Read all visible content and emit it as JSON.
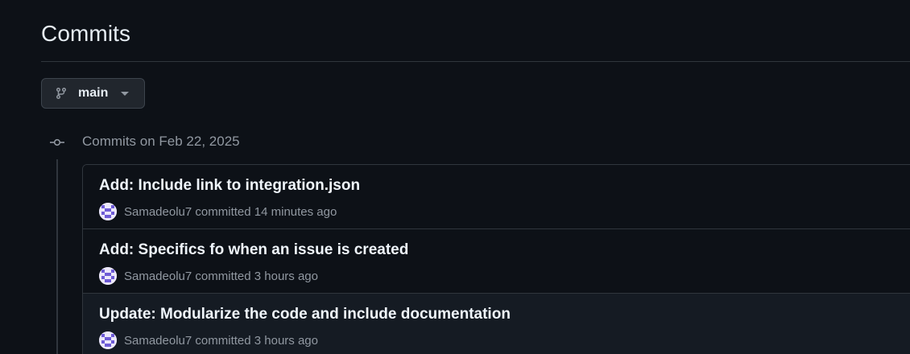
{
  "header": {
    "title": "Commits"
  },
  "branch_selector": {
    "icon": "git-branch-icon",
    "label": "main",
    "caret_icon": "triangle-down-icon"
  },
  "timeline": {
    "date_heading": "Commits on Feb 22, 2025",
    "node_icon": "git-commit-icon",
    "commits": [
      {
        "title": "Add: Include link to integration.json",
        "author": "Samadeolu7",
        "verb": "committed",
        "time": "14 minutes ago"
      },
      {
        "title": "Add: Specifics fo when an issue is created",
        "author": "Samadeolu7",
        "verb": "committed",
        "time": "3 hours ago"
      },
      {
        "title": "Update: Modularize the code and include documentation",
        "author": "Samadeolu7",
        "verb": "committed",
        "time": "3 hours ago"
      }
    ]
  },
  "colors": {
    "background": "#0d1117",
    "border": "#30363d",
    "muted_text": "#9198a1",
    "primary_text": "#f0f6fc",
    "avatar_accent": "#6e5bd6"
  }
}
